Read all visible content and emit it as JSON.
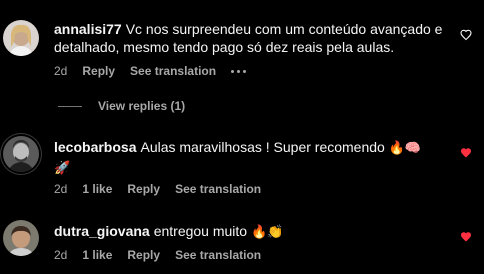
{
  "colors": {
    "background": "#000000",
    "text": "#f5f5f5",
    "muted": "#a8a8a8",
    "like_red": "#ff3040"
  },
  "comments": [
    {
      "username": "annalisi77",
      "text": "Vc nos surpreendeu com um conteúdo avançado e detalhado, mesmo tendo pago só dez reais pela aulas.",
      "time": "2d",
      "reply": "Reply",
      "see_translation": "See translation",
      "liked": false,
      "heart_icon": "heart-outline-icon",
      "more_icon": "more-dots-icon"
    },
    {
      "username": "lecobarbosa",
      "text": "Aulas maravilhosas ! Super recomendo",
      "emojis": "🔥🧠",
      "emoji_line2": "🚀",
      "time": "2d",
      "likes": "1 like",
      "reply": "Reply",
      "see_translation": "See translation",
      "liked": true,
      "heart_icon": "heart-filled-icon"
    },
    {
      "username": "dutra_giovana",
      "text": "entregou muito",
      "emojis": "🔥👏",
      "time": "2d",
      "likes": "1 like",
      "reply": "Reply",
      "see_translation": "See translation",
      "liked": true,
      "heart_icon": "heart-filled-icon"
    }
  ],
  "view_replies": "View replies (1)"
}
